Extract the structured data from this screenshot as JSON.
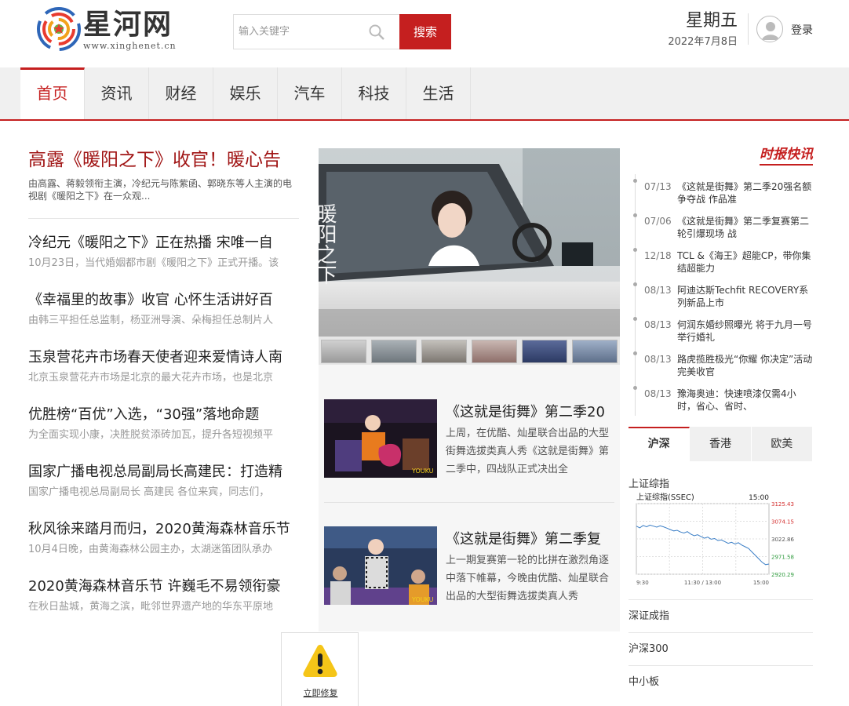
{
  "header": {
    "logo_name": "星河网",
    "logo_domain": "www.xinghenet.cn",
    "search_placeholder": "输入关键字",
    "search_button": "搜索",
    "weekday": "星期五",
    "date": "2022年7月8日",
    "login": "登录"
  },
  "nav": {
    "items": [
      "首页",
      "资讯",
      "财经",
      "娱乐",
      "汽车",
      "科技",
      "生活"
    ],
    "active": "首页"
  },
  "lead": {
    "title": "高露《暖阳之下》收官！暖心告",
    "desc": "由高露、蒋毅领衔主演，冷纪元与陈紫函、郭晓东等人主演的电视剧《暖阳之下》在一众观..."
  },
  "news": [
    {
      "title": "冷纪元《暖阳之下》正在热播 宋唯一自",
      "desc": "10月23日，当代婚姻都市剧《暖阳之下》正式开播。该"
    },
    {
      "title": "《幸福里的故事》收官 心怀生活讲好百",
      "desc": "由韩三平担任总监制，杨亚洲导演、朵梅担任总制片人"
    },
    {
      "title": "玉泉营花卉市场春天使者迎来爱情诗人南",
      "desc": "北京玉泉营花卉市场是北京的最大花卉市场，也是北京"
    },
    {
      "title": "优胜榜“百优”入选，“30强”落地命题",
      "desc": "为全面实现小康，决胜脱贫添砖加瓦，提升各短视频平"
    },
    {
      "title": "国家广播电视总局副局长高建民：打造精",
      "desc": "国家广播电视总局副局长 高建民 各位来宾，同志们，"
    },
    {
      "title": "秋风徐来踏月而归，2020黄海森林音乐节",
      "desc": "10月4日晚，由黄海森林公园主办，太湖迷笛团队承办"
    },
    {
      "title": "2020黄海森林音乐节 许巍毛不易领衔豪",
      "desc": "在秋日盐城，黄海之滨，毗邻世界遗产地的华东平原地"
    }
  ],
  "slide": {
    "caption_glyphs": "暖阳之下"
  },
  "features": [
    {
      "title": "《这就是街舞》第二季20",
      "desc": "上周，在优酷、灿星联合出品的大型街舞选拔类真人秀《这就是街舞》第二季中，四战队正式决出全",
      "img_text": "YOUKU"
    },
    {
      "title": "《这就是街舞》第二季复",
      "desc": "上一期复赛第一轮的比拼在激烈角逐中落下帷幕，今晚由优酷、灿星联合出品的大型街舞选拔类真人秀",
      "img_text": "YOUKU"
    }
  ],
  "flash": {
    "title": "时报快讯",
    "items": [
      {
        "date": "07/13",
        "text": "《这就是街舞》第二季20强名额争夺战 作品准"
      },
      {
        "date": "07/06",
        "text": "《这就是街舞》第二季复赛第二轮引爆现场 战"
      },
      {
        "date": "12/18",
        "text": "TCL &《海王》超能CP，带你集结超能力"
      },
      {
        "date": "08/13",
        "text": "阿迪达斯Techfit RECOVERY系列新品上市"
      },
      {
        "date": "08/13",
        "text": "何润东婚纱照曝光 将于九月一号举行婚礼"
      },
      {
        "date": "08/13",
        "text": "路虎揽胜极光“你耀 你决定”活动完美收官"
      },
      {
        "date": "08/13",
        "text": "豫海奥迪：快速喷漆仅需4小时，省心、省时、"
      }
    ]
  },
  "stocks": {
    "tabs": [
      "沪深",
      "香港",
      "欧美"
    ],
    "active": "沪深",
    "index_name": "上证综指",
    "chart_title": "上证综指(SSEC)",
    "chart_time": "15:00",
    "others": [
      "深证成指",
      "沪深300",
      "中小板"
    ]
  },
  "chart_data": {
    "type": "line",
    "title": "上证综指(SSEC)",
    "x_ticks": [
      "9:30",
      "11:30 / 13:00",
      "15:00"
    ],
    "y_ticks": [
      3125.43,
      3074.15,
      3022.86,
      2971.58,
      2920.29
    ],
    "ylim": [
      2920.29,
      3125.43
    ],
    "series": [
      {
        "values": [
          3060,
          3055,
          3062,
          3058,
          3063,
          3060,
          3057,
          3061,
          3058,
          3054,
          3050,
          3046,
          3048,
          3043,
          3040,
          3044,
          3037,
          3032,
          3035,
          3030,
          3025,
          3028,
          3022,
          3024,
          3018,
          3020,
          3015,
          3010,
          3013,
          3008,
          3012,
          3005,
          3000,
          2995,
          2985,
          2975,
          2965,
          2955,
          2948,
          2950
        ]
      }
    ],
    "colors": {
      "line": "#3a7ec6",
      "up": "#d43030",
      "down": "#2d9a3c"
    },
    "grid": true
  },
  "warning": {
    "link": "立即修复"
  },
  "colors": {
    "accent": "#c51f1f",
    "lead_title": "#a01414"
  }
}
